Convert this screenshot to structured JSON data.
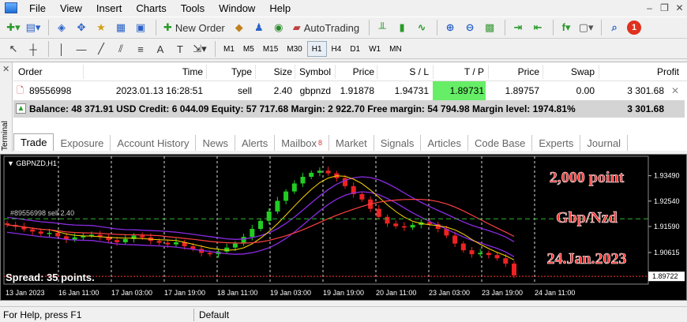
{
  "menu": {
    "items": [
      "File",
      "View",
      "Insert",
      "Charts",
      "Tools",
      "Window",
      "Help"
    ]
  },
  "toolbar": {
    "new_order": "New Order",
    "autotrading": "AutoTrading",
    "alert_count": "1"
  },
  "timeframes": [
    "M1",
    "M5",
    "M15",
    "M30",
    "H1",
    "H4",
    "D1",
    "W1",
    "MN"
  ],
  "active_timeframe": "H1",
  "terminal": {
    "side_label": "Terminal",
    "columns": [
      "Order",
      "Time",
      "Type",
      "Size",
      "Symbol",
      "Price",
      "S / L",
      "T / P",
      "Price",
      "Swap",
      "Profit"
    ],
    "order": {
      "order": "89556998",
      "time": "2023.01.13 16:28:51",
      "type": "sell",
      "size": "2.40",
      "symbol": "gbpnzd",
      "price": "1.91878",
      "sl": "1.94731",
      "tp": "1.89731",
      "cur_price": "1.89757",
      "swap": "0.00",
      "profit": "3 301.68"
    },
    "balance_line": "Balance: 48 371.91 USD  Credit: 6 044.09  Equity: 57 717.68  Margin: 2 922.70  Free margin: 54 794.98  Margin level: 1974.81%",
    "balance_profit": "3 301.68",
    "tabs": [
      "Trade",
      "Exposure",
      "Account History",
      "News",
      "Alerts",
      "Mailbox",
      "Market",
      "Signals",
      "Articles",
      "Code Base",
      "Experts",
      "Journal"
    ],
    "mailbox_badge": "8",
    "active_tab": "Trade"
  },
  "chart": {
    "symbol_label": "GBPNZD,H1",
    "order_line_label": "#89556998 sell 2.40",
    "spread_text": "Spread: 35 points.",
    "annotations": [
      "2,000 point",
      "Gbp/Nzd",
      "24.Jan.2023"
    ],
    "price_labels": [
      "1.93490",
      "1.92540",
      "1.91590",
      "1.90615",
      "1.89722"
    ],
    "time_labels": [
      "13 Jan 2023",
      "16 Jan 11:00",
      "17 Jan 03:00",
      "17 Jan 19:00",
      "18 Jan 11:00",
      "19 Jan 03:00",
      "19 Jan 19:00",
      "20 Jan 11:00",
      "23 Jan 03:00",
      "23 Jan 19:00",
      "24 Jan 11:00"
    ],
    "colors": {
      "bull": "#22cc22",
      "bear": "#ee2222",
      "annotation": "#ff3333",
      "band": "#8a2be2",
      "ma_fast": "#ffd700",
      "ma_slow": "#ff4040"
    }
  },
  "chart_data": {
    "type": "candlestick",
    "title": "GBPNZD,H1",
    "ylim": [
      1.8955,
      1.941
    ],
    "x_ticks": [
      "13 Jan 2023",
      "16 Jan 11:00",
      "17 Jan 03:00",
      "17 Jan 19:00",
      "18 Jan 11:00",
      "19 Jan 03:00",
      "19 Jan 19:00",
      "20 Jan 11:00",
      "23 Jan 03:00",
      "23 Jan 19:00",
      "24 Jan 11:00"
    ],
    "y_ticks": [
      1.9349,
      1.9254,
      1.9159,
      1.90615
    ],
    "close_path": [
      1.9165,
      1.9158,
      1.9148,
      1.914,
      1.9132,
      1.9135,
      1.9122,
      1.911,
      1.9118,
      1.9125,
      1.9128,
      1.912,
      1.9108,
      1.91,
      1.9112,
      1.9125,
      1.9118,
      1.9105,
      1.9098,
      1.9092,
      1.91,
      1.9085,
      1.9075,
      1.906,
      1.9055,
      1.9065,
      1.908,
      1.9095,
      1.912,
      1.915,
      1.918,
      1.9215,
      1.9255,
      1.929,
      1.932,
      1.9345,
      1.936,
      1.9368,
      1.9358,
      1.934,
      1.931,
      1.928,
      1.926,
      1.9225,
      1.9195,
      1.917,
      1.916,
      1.9155,
      1.9165,
      1.9175,
      1.9168,
      1.915,
      1.9125,
      1.9095,
      1.907,
      1.9055,
      1.906,
      1.9052,
      1.904,
      1.902,
      1.8976
    ],
    "horizontal_lines": {
      "order_open": 1.91878,
      "stop_loss": 1.94731,
      "take_profit": 1.89731,
      "bid": 1.89722
    }
  }
}
